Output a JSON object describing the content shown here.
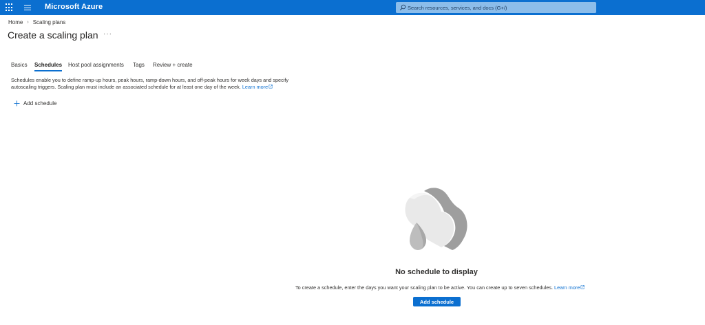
{
  "header": {
    "brand": "Microsoft Azure",
    "search_placeholder": "Search resources, services, and docs (G+/)",
    "color": "#0b6fd0"
  },
  "breadcrumb": {
    "items": [
      "Home",
      "Scaling plans"
    ]
  },
  "page": {
    "title": "Create a scaling plan",
    "more_label": "···"
  },
  "tabs": [
    {
      "label": "Basics",
      "active": false
    },
    {
      "label": "Schedules",
      "active": true
    },
    {
      "label": "Host pool assignments",
      "active": false
    },
    {
      "label": "Tags",
      "active": false
    },
    {
      "label": "Review + create",
      "active": false
    }
  ],
  "description": {
    "text": "Schedules enable you to define ramp-up hours, peak hours, ramp-down hours, and off-peak hours for week days and specify autoscaling triggers. Scaling plan must include an associated schedule for at least one day of the week.",
    "link_label": "Learn more"
  },
  "toolbar": {
    "add_schedule_label": "Add schedule"
  },
  "empty_state": {
    "title": "No schedule to display",
    "description": "To create a schedule, enter the days you want your scaling plan to be active. You can create up to seven schedules.",
    "link_label": "Learn more",
    "button_label": "Add schedule"
  },
  "icons": {
    "waffle": "app-launcher-icon",
    "menu": "hamburger-menu-icon",
    "search": "search-icon",
    "external": "external-link-icon",
    "add": "plus-icon",
    "illustration": "cloud-illustration-icon"
  }
}
